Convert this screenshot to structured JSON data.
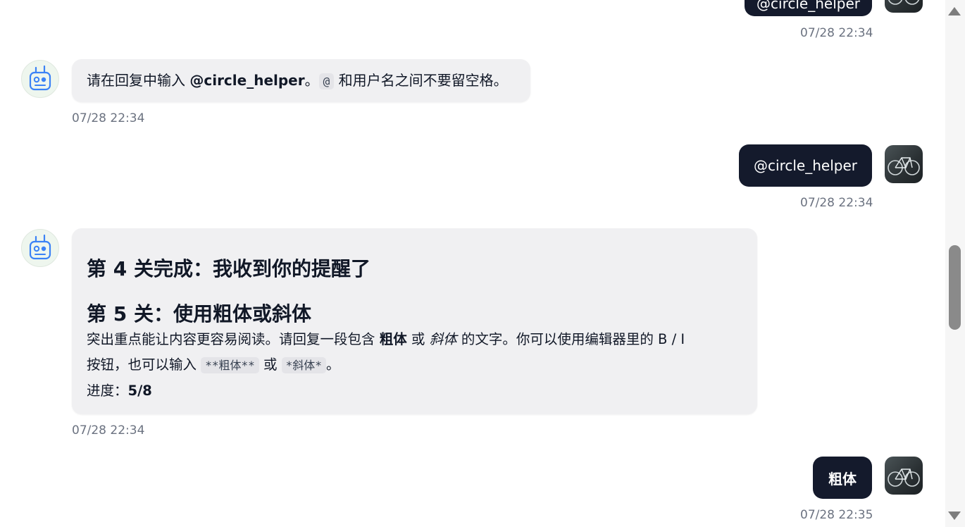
{
  "colors": {
    "user_bubble": "#141a2c",
    "bot_bubble": "#f0f0f2",
    "timestamp": "#6b7280",
    "bot_icon": "#3b82f6"
  },
  "messages": [
    {
      "role": "user",
      "text": "@circle_helper",
      "time": "07/28 22:34",
      "partially_visible": true
    },
    {
      "role": "bot",
      "time": "07/28 22:34",
      "parts": {
        "prefix": "请在回复中输入 ",
        "mention": "@circle_helper",
        "mid": "。",
        "code": "@",
        "suffix": " 和用户名之间不要留空格。"
      }
    },
    {
      "role": "user",
      "text": "@circle_helper",
      "time": "07/28 22:34"
    },
    {
      "role": "bot",
      "time": "07/28 22:34",
      "heading1": "第 4 关完成：我收到你的提醒了",
      "heading2": "第 5 关：使用粗体或斜体",
      "body": {
        "p1": "突出重点能让内容更容易阅读。请回复一段包含 ",
        "bold": "粗体",
        "or1": " 或 ",
        "italic": "斜体",
        "p2": " 的文字。你可以使用编辑器里的 B / I",
        "p3": "按钮，也可以输入 ",
        "code1": "**粗体**",
        "or2": " 或 ",
        "code2": "*斜体*",
        "p4": "。"
      },
      "progress_label": "进度：",
      "progress_value": "5/8"
    },
    {
      "role": "user",
      "text": "粗体",
      "time": "07/28 22:35"
    }
  ],
  "icons": {
    "bot_avatar": "robot-icon",
    "user_avatar": "bicycle-photo"
  }
}
